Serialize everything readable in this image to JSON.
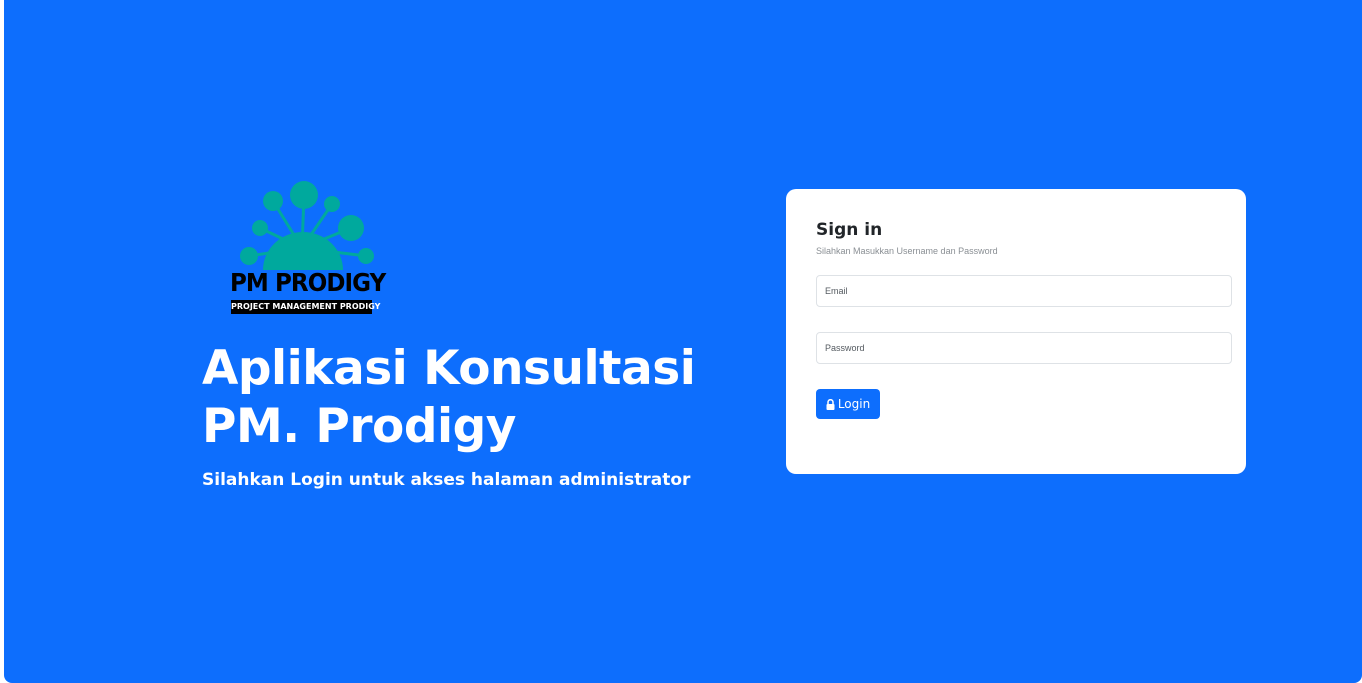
{
  "brand": {
    "logo_main_text": "PM PRODIGY",
    "logo_sub_text": "PROJECT MANAGEMENT PRODIGY",
    "logo_accent_color": "#00a99d",
    "logo_text_color": "#000000",
    "icon": "pm-prodigy-logo"
  },
  "hero": {
    "title_line1": "Aplikasi Konsultasi",
    "title_line2": "PM. Prodigy",
    "subtitle": "Silahkan Login untuk akses halaman administrator",
    "background_color": "#0d6efd"
  },
  "login": {
    "title": "Sign in",
    "subtitle": "Silahkan Masukkan Username dan Password",
    "email_placeholder": "Email",
    "email_value": "",
    "password_placeholder": "Password",
    "password_value": "",
    "button_label": "Login",
    "button_icon": "lock-icon",
    "button_color": "#0d6efd"
  }
}
